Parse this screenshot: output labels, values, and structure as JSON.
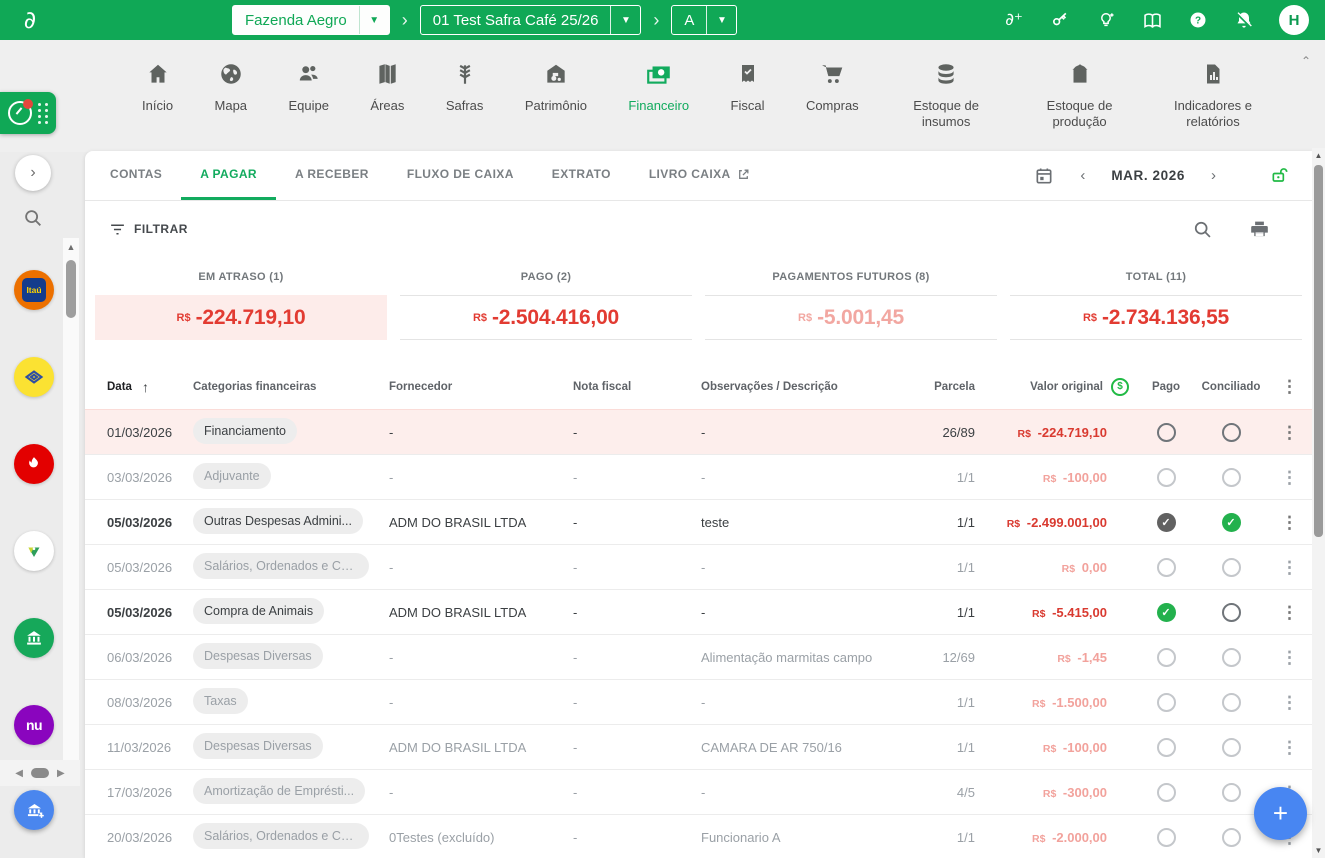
{
  "topbar": {
    "farm_selector": "Fazenda Aegro",
    "season_selector": "01 Test Safra Café 25/26",
    "field_selector": "A",
    "avatar_initial": "H"
  },
  "nav": {
    "items": [
      {
        "label": "Início"
      },
      {
        "label": "Mapa"
      },
      {
        "label": "Equipe"
      },
      {
        "label": "Áreas"
      },
      {
        "label": "Safras"
      },
      {
        "label": "Patrimônio"
      },
      {
        "label": "Financeiro",
        "active": true
      },
      {
        "label": "Fiscal"
      },
      {
        "label": "Compras"
      },
      {
        "label": "Estoque de insumos"
      },
      {
        "label": "Estoque de produção"
      },
      {
        "label": "Indicadores e relatórios"
      }
    ]
  },
  "sidebar": {
    "banks": [
      {
        "name": "itau",
        "label": "Itaú",
        "color": "#ec7000"
      },
      {
        "name": "banco-do-brasil",
        "color": "#fbe232"
      },
      {
        "name": "santander",
        "color": "#e30000"
      },
      {
        "name": "sicredi",
        "color": "#ffffff"
      },
      {
        "name": "bank-green",
        "color": "#16a85a"
      },
      {
        "name": "nubank",
        "label": "nu",
        "color": "#8a05be"
      },
      {
        "name": "bank-add",
        "color": "#4a86ee"
      }
    ]
  },
  "content": {
    "tabs": [
      {
        "label": "CONTAS"
      },
      {
        "label": "A PAGAR",
        "active": true
      },
      {
        "label": "A RECEBER"
      },
      {
        "label": "FLUXO DE CAIXA"
      },
      {
        "label": "EXTRATO"
      },
      {
        "label": "LIVRO CAIXA",
        "external": true
      }
    ],
    "period_label": "MAR. 2026",
    "filter_label": "FILTRAR",
    "summary_cards": [
      {
        "label": "EM ATRASO (1)",
        "currency": "R$",
        "amount": "-224.719,10",
        "variant": "overdue"
      },
      {
        "label": "PAGO (2)",
        "currency": "R$",
        "amount": "-2.504.416,00",
        "variant": "strong"
      },
      {
        "label": "PAGAMENTOS FUTUROS (8)",
        "currency": "R$",
        "amount": "-5.001,45",
        "variant": "muted"
      },
      {
        "label": "TOTAL (11)",
        "currency": "R$",
        "amount": "-2.734.136,55",
        "variant": "strong"
      }
    ],
    "table": {
      "headers": {
        "date": "Data",
        "category": "Categorias financeiras",
        "supplier": "Fornecedor",
        "invoice": "Nota fiscal",
        "note": "Observações / Descrição",
        "installment": "Parcela",
        "amount": "Valor original",
        "paid": "Pago",
        "reconciled": "Conciliado"
      },
      "rows": [
        {
          "date": "01/03/2026",
          "category": "Financiamento",
          "supplier": "-",
          "invoice": "-",
          "note": "-",
          "installment": "26/89",
          "currency": "R$",
          "amount": "-224.719,10",
          "paid": "circle",
          "reconciled": "circle",
          "state": "overdue"
        },
        {
          "date": "03/03/2026",
          "category": "Adjuvante",
          "supplier": "-",
          "invoice": "-",
          "note": "-",
          "installment": "1/1",
          "currency": "R$",
          "amount": "-100,00",
          "paid": "circle",
          "reconciled": "circle",
          "state": "future"
        },
        {
          "date": "05/03/2026",
          "category": "Outras Despesas Admini...",
          "supplier": "ADM DO BRASIL LTDA",
          "invoice": "-",
          "note": "teste",
          "installment": "1/1",
          "currency": "R$",
          "amount": "-2.499.001,00",
          "paid": "check-dark",
          "reconciled": "check-green",
          "state": "paid"
        },
        {
          "date": "05/03/2026",
          "category": "Salários, Ordenados e Co...",
          "supplier": "-",
          "invoice": "-",
          "note": "-",
          "installment": "1/1",
          "currency": "R$",
          "amount": "0,00",
          "paid": "circle",
          "reconciled": "circle",
          "state": "future"
        },
        {
          "date": "05/03/2026",
          "category": "Compra de Animais",
          "supplier": "ADM DO BRASIL LTDA",
          "invoice": "-",
          "note": "-",
          "installment": "1/1",
          "currency": "R$",
          "amount": "-5.415,00",
          "paid": "check-green",
          "reconciled": "circle",
          "state": "paid"
        },
        {
          "date": "06/03/2026",
          "category": "Despesas Diversas",
          "supplier": "-",
          "invoice": "-",
          "note": "Alimentação marmitas campo",
          "installment": "12/69",
          "currency": "R$",
          "amount": "-1,45",
          "paid": "circle",
          "reconciled": "circle",
          "state": "future"
        },
        {
          "date": "08/03/2026",
          "category": "Taxas",
          "supplier": "-",
          "invoice": "-",
          "note": "-",
          "installment": "1/1",
          "currency": "R$",
          "amount": "-1.500,00",
          "paid": "circle",
          "reconciled": "circle",
          "state": "future"
        },
        {
          "date": "11/03/2026",
          "category": "Despesas Diversas",
          "supplier": "ADM DO BRASIL LTDA",
          "invoice": "-",
          "note": "CAMARA DE AR 750/16",
          "installment": "1/1",
          "currency": "R$",
          "amount": "-100,00",
          "paid": "circle",
          "reconciled": "circle",
          "state": "future"
        },
        {
          "date": "17/03/2026",
          "category": "Amortização de Emprésti...",
          "supplier": "-",
          "invoice": "-",
          "note": "-",
          "installment": "4/5",
          "currency": "R$",
          "amount": "-300,00",
          "paid": "circle",
          "reconciled": "circle",
          "state": "future"
        },
        {
          "date": "20/03/2026",
          "category": "Salários, Ordenados e Co...",
          "supplier": "0Testes (excluído)",
          "invoice": "-",
          "note": "Funcionario A",
          "installment": "1/1",
          "currency": "R$",
          "amount": "-2.000,00",
          "paid": "circle",
          "reconciled": "circle",
          "state": "future"
        }
      ]
    }
  },
  "icons": {
    "breadcrumb_chevron": "›",
    "prev": "‹",
    "next": "›",
    "kebab": "⋮",
    "sort_asc": "↑",
    "collapse": "⌃",
    "expand_right": "›",
    "scroll_up": "▲",
    "scroll_down": "▼",
    "scroll_left": "◀",
    "scroll_right": "▶",
    "plus": "+",
    "coin_symbol": "$",
    "check": "✓"
  },
  "colors": {
    "brand_green": "#10a856",
    "active_green": "#12ab5e",
    "check_green": "#23b14d",
    "alert_red": "#e23b32",
    "muted_red": "#f2a7a1",
    "overdue_row_bg": "#fdeeec",
    "fab_blue": "#4886f2"
  }
}
